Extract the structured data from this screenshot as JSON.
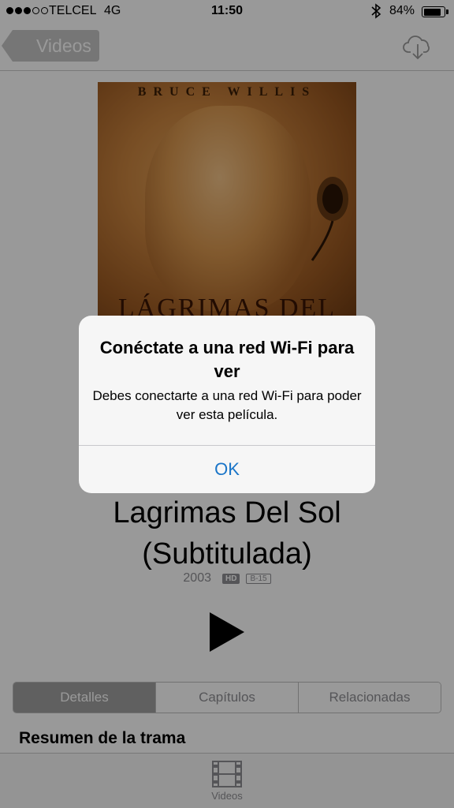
{
  "status_bar": {
    "carrier": "TELCEL",
    "network": "4G",
    "time": "11:50",
    "battery_percent": "84%",
    "battery_level": 0.84,
    "signal_bars_filled": 3,
    "signal_bars_total": 5
  },
  "nav": {
    "back_label": "Videos",
    "download_icon": "cloud-download-icon"
  },
  "poster": {
    "actor": "BRUCE WILLIS",
    "title": "LÁGRIMAS DEL SOL"
  },
  "movie": {
    "title_line1": "Lagrimas Del Sol",
    "title_line2": "(Subtitulada)",
    "year": "2003",
    "hd_badge": "HD",
    "rating": "B-15"
  },
  "segments": {
    "items": [
      "Detalles",
      "Capítulos",
      "Relacionadas"
    ],
    "selected": "Detalles"
  },
  "section": {
    "heading": "Resumen de la trama"
  },
  "tabbar": {
    "videos_label": "Videos"
  },
  "alert": {
    "title": "Conéctate a una red Wi-Fi para ver",
    "message": "Debes conectarte a una red Wi-Fi para poder ver esta película.",
    "ok_label": "OK"
  },
  "colors": {
    "accent": "#1a75c8",
    "segment_active": "#a0a0a0"
  }
}
